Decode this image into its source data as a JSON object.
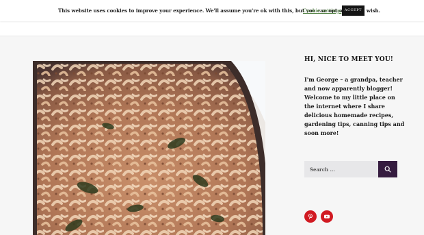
{
  "cookie_bar": {
    "message": "This website uses cookies to improve your experience. We'll assume you're ok with this, but you can opt-out if you wish.",
    "settings_label": "Cookie settings",
    "accept_label": "ACCEPT"
  },
  "header": {
    "fragment": ""
  },
  "sidebar": {
    "title": "HI, NICE TO MEET YOU!",
    "bio": "I'm George – a grandpa, teacher and now apparently blogger! Welcome to my little place on the internet where I share delicious homemade recipes, gardening tips, canning tips and soon more!",
    "search_placeholder": "Search ...",
    "social": [
      {
        "name": "pinterest",
        "icon": "pinterest-icon"
      },
      {
        "name": "youtube",
        "icon": "youtube-icon"
      }
    ]
  },
  "colors": {
    "accent": "#361c40",
    "social": "#d11a22",
    "background": "#f6f6f6"
  }
}
